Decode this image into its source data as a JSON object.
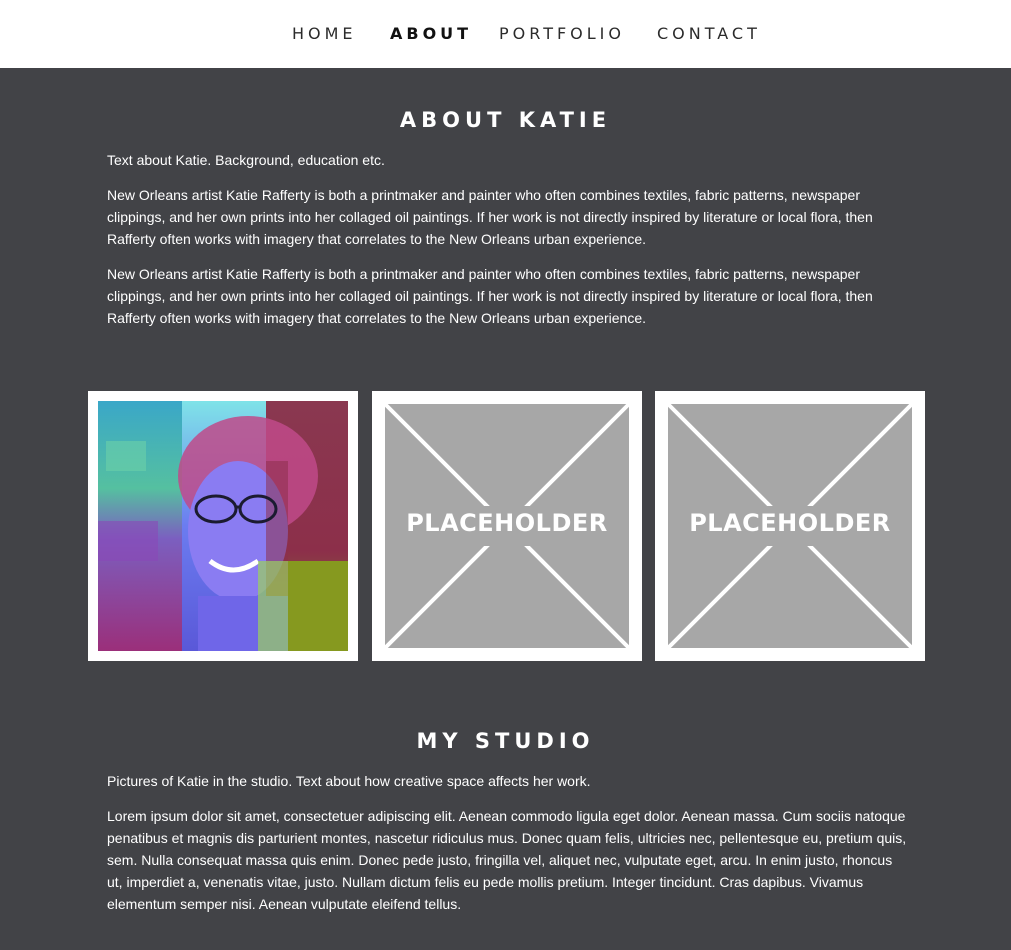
{
  "nav": {
    "items": [
      {
        "label": "HOME",
        "active": false
      },
      {
        "label": "ABOUT",
        "active": true
      },
      {
        "label": "PORTFOLIO",
        "active": false
      },
      {
        "label": "CONTACT",
        "active": false
      }
    ]
  },
  "about": {
    "title": "ABOUT KATIE",
    "intro": "Text about Katie. Background, education etc.",
    "paragraph_1": "New Orleans artist Katie Rafferty is both a printmaker and painter who often combines textiles, fabric patterns, newspaper clippings, and her own prints into her collaged oil paintings. If her work is not directly inspired by literature or local flora, then Rafferty often works with imagery that correlates to the New Orleans urban experience.",
    "paragraph_2": "New Orleans artist Katie Rafferty is both a printmaker and painter who often combines textiles, fabric patterns, newspaper clippings, and her own prints into her collaged oil paintings. If her work is not directly inspired by literature or local flora, then Rafferty often works with imagery that correlates to the New Orleans urban experience."
  },
  "gallery": {
    "placeholder_1": "PLACEHOLDER",
    "placeholder_2": "PLACEHOLDER"
  },
  "studio": {
    "title": "MY STUDIO",
    "intro": "Pictures of Katie in the studio. Text about how creative space affects her work.",
    "paragraph": "Lorem ipsum dolor sit amet, consectetuer adipiscing elit. Aenean commodo ligula eget dolor. Aenean massa. Cum sociis natoque penatibus et magnis dis parturient montes, nascetur ridiculus mus. Donec quam felis, ultricies nec, pellentesque eu, pretium quis, sem. Nulla consequat massa quis enim. Donec pede justo, fringilla vel, aliquet nec, vulputate eget, arcu. In enim justo, rhoncus ut, imperdiet a, venenatis vitae, justo. Nullam dictum felis eu pede mollis pretium. Integer tincidunt. Cras dapibus. Vivamus elementum semper nisi. Aenean vulputate eleifend tellus."
  },
  "colors": {
    "page_background": "#424347",
    "nav_background": "#ffffff",
    "placeholder_gray": "#a7a7a7"
  }
}
